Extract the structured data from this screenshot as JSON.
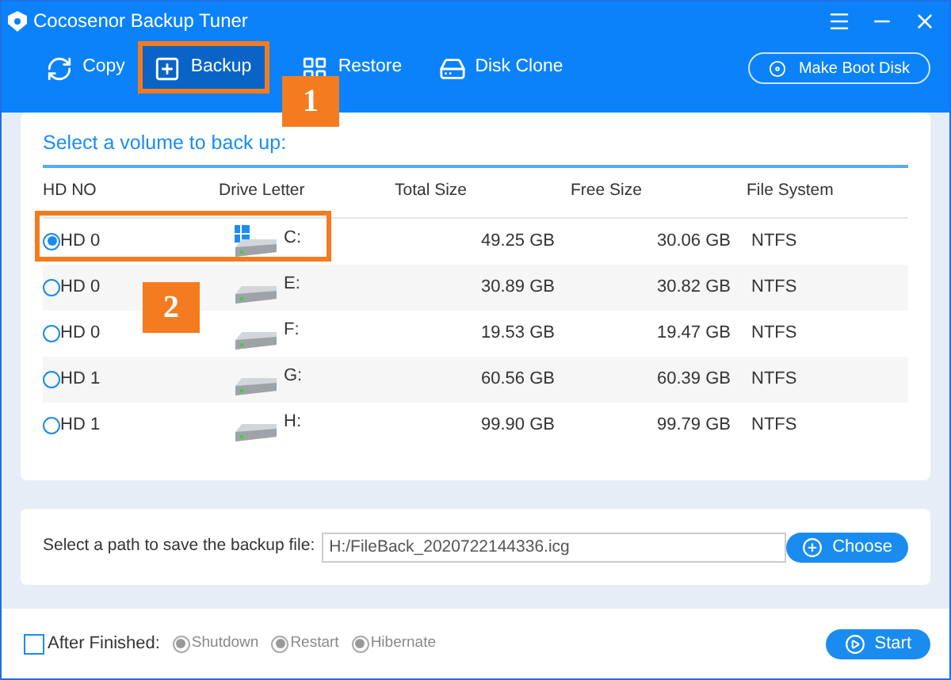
{
  "window": {
    "title": "Cocosenor Backup Tuner"
  },
  "toolbar": [
    {
      "label": "Copy",
      "kind": "copy",
      "selected": false
    },
    {
      "label": "Backup",
      "kind": "backup",
      "selected": true
    },
    {
      "label": "Restore",
      "kind": "restore",
      "selected": false
    },
    {
      "label": "Disk Clone",
      "kind": "clone",
      "selected": false
    }
  ],
  "boot_button": "Make Boot Disk",
  "volume_panel": {
    "title": "Select a volume to back up:",
    "columns": [
      "HD NO",
      "Drive Letter",
      "Total Size",
      "Free Size",
      "File System"
    ],
    "rows": [
      {
        "hd": "HD 0",
        "letter": "C:",
        "system_drive": true,
        "total": "49.25 GB",
        "free": "30.06 GB",
        "fs": "NTFS",
        "selected": true
      },
      {
        "hd": "HD 0",
        "letter": "E:",
        "system_drive": false,
        "total": "30.89 GB",
        "free": "30.82 GB",
        "fs": "NTFS",
        "selected": false
      },
      {
        "hd": "HD 0",
        "letter": "F:",
        "system_drive": false,
        "total": "19.53 GB",
        "free": "19.47 GB",
        "fs": "NTFS",
        "selected": false
      },
      {
        "hd": "HD 1",
        "letter": "G:",
        "system_drive": false,
        "total": "60.56 GB",
        "free": "60.39 GB",
        "fs": "NTFS",
        "selected": false
      },
      {
        "hd": "HD 1",
        "letter": "H:",
        "system_drive": false,
        "total": "99.90 GB",
        "free": "99.79 GB",
        "fs": "NTFS",
        "selected": false
      }
    ]
  },
  "path_panel": {
    "label": "Select a path to save the backup file:",
    "value": "H:/FileBack_2020722144336.icg",
    "button": "Choose"
  },
  "footer": {
    "after_finished": {
      "label": "After Finished:",
      "checked": false
    },
    "options": [
      {
        "label": "Shutdown",
        "disabled": true
      },
      {
        "label": "Restart",
        "disabled": true
      },
      {
        "label": "Hibernate",
        "disabled": true
      }
    ],
    "start": "Start"
  },
  "annotations": [
    {
      "label": "1",
      "kind": "toolbar"
    },
    {
      "label": "2",
      "kind": "row"
    }
  ]
}
